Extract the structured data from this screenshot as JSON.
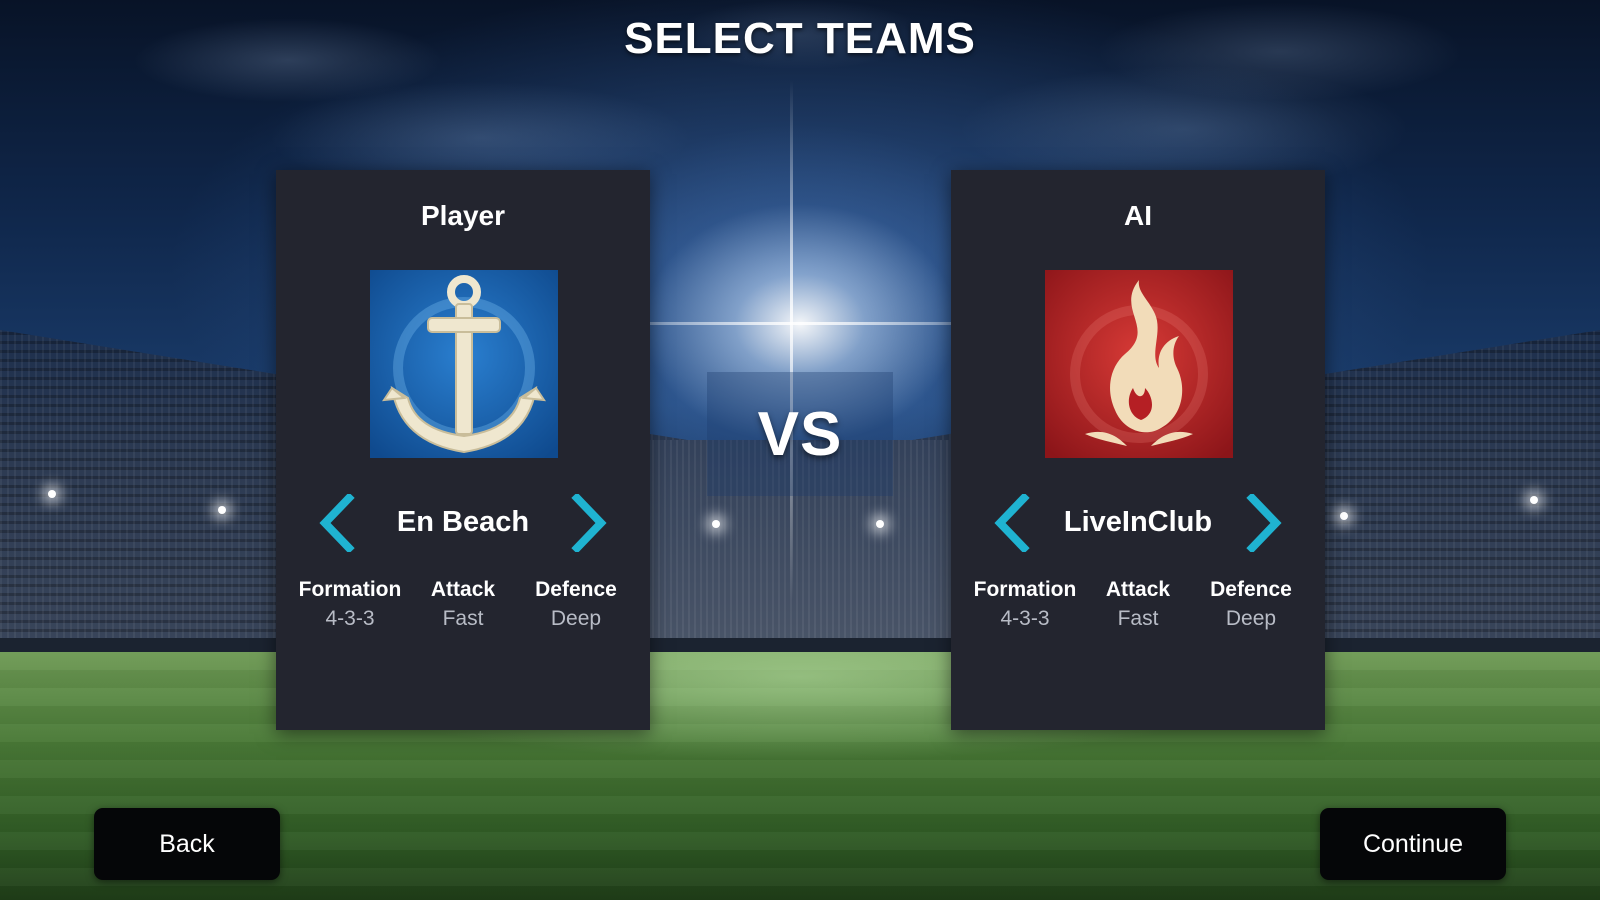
{
  "screen": {
    "title": "SELECT TEAMS",
    "vs_label": "VS"
  },
  "player": {
    "heading": "Player",
    "team_name": "En Beach",
    "badge_icon": "anchor-icon",
    "badge_color": "#1b63b3",
    "stats": [
      {
        "label": "Formation",
        "value": "4-3-3"
      },
      {
        "label": "Attack",
        "value": "Fast"
      },
      {
        "label": "Defence",
        "value": "Deep"
      }
    ]
  },
  "ai": {
    "heading": "AI",
    "team_name": "LiveInClub",
    "badge_icon": "flame-icon",
    "badge_color": "#c0242b",
    "stats": [
      {
        "label": "Formation",
        "value": "4-3-3"
      },
      {
        "label": "Attack",
        "value": "Fast"
      },
      {
        "label": "Defence",
        "value": "Deep"
      }
    ]
  },
  "buttons": {
    "back": "Back",
    "continue": "Continue"
  },
  "colors": {
    "arrow": "#1fb3d1",
    "panel": "#23252f",
    "button": "#050608"
  }
}
